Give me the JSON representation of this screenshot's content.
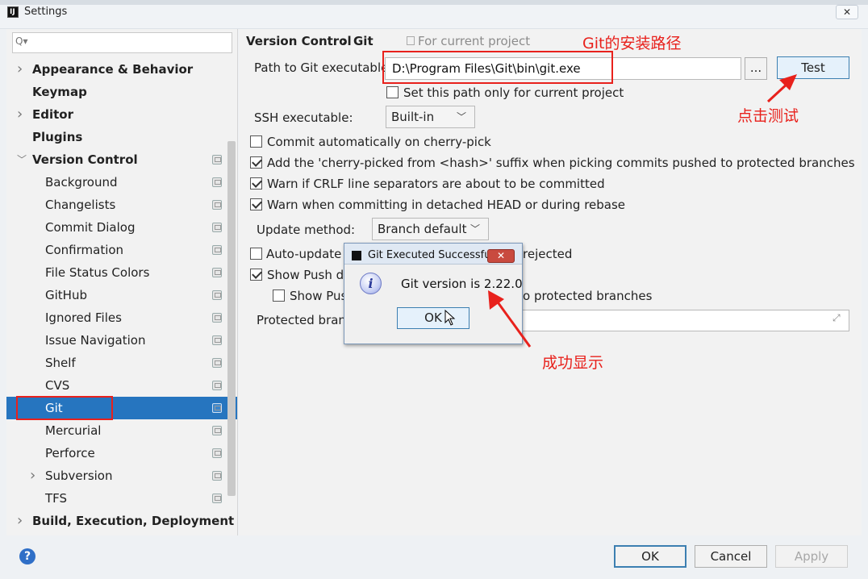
{
  "window": {
    "title": "Settings",
    "close_glyph": "✕"
  },
  "sidebar": {
    "search_placeholder": "Q▾",
    "items": [
      {
        "label": "Appearance & Behavior",
        "bold": true,
        "chevron": "right"
      },
      {
        "label": "Keymap",
        "bold": true
      },
      {
        "label": "Editor",
        "bold": true,
        "chevron": "right"
      },
      {
        "label": "Plugins",
        "bold": true
      },
      {
        "label": "Version Control",
        "bold": true,
        "chevron": "down",
        "project": true
      },
      {
        "label": "Background",
        "project": true
      },
      {
        "label": "Changelists",
        "project": true
      },
      {
        "label": "Commit Dialog",
        "project": true
      },
      {
        "label": "Confirmation",
        "project": true
      },
      {
        "label": "File Status Colors",
        "project": true
      },
      {
        "label": "GitHub",
        "project": true
      },
      {
        "label": "Ignored Files",
        "project": true
      },
      {
        "label": "Issue Navigation",
        "project": true
      },
      {
        "label": "Shelf",
        "project": true
      },
      {
        "label": "CVS",
        "project": true
      },
      {
        "label": "Git",
        "project": true,
        "selected": true
      },
      {
        "label": "Mercurial",
        "project": true
      },
      {
        "label": "Perforce",
        "project": true
      },
      {
        "label": "Subversion",
        "project": true,
        "chevron": "right"
      },
      {
        "label": "TFS",
        "project": true
      },
      {
        "label": "Build, Execution, Deployment",
        "bold": true,
        "chevron": "right"
      }
    ]
  },
  "breadcrumb": {
    "part1": "Version Control",
    "separator": "›",
    "part2": "Git",
    "scope": "For current project"
  },
  "git": {
    "path_label": "Path to Git executable:",
    "path_value": "D:\\Program Files\\Git\\bin\\git.exe",
    "browse_label": "...",
    "test_label": "Test",
    "set_path_label": "Set this path only for current project",
    "ssh_label": "SSH executable:",
    "ssh_value": "Built-in",
    "checkboxes": [
      {
        "label": "Commit automatically on cherry-pick",
        "checked": false
      },
      {
        "label": "Add the 'cherry-picked from <hash>' suffix when picking commits pushed to protected branches",
        "checked": true
      },
      {
        "label": "Warn if CRLF line separators are about to be committed",
        "checked": true
      },
      {
        "label": "Warn when committing in detached HEAD or during rebase",
        "checked": true
      }
    ],
    "update_method_label": "Update method:",
    "update_method_value": "Branch default",
    "auto_update_label": "Auto-update i",
    "auto_update_tail": "rejected",
    "show_push_label": "Show Push dia",
    "show_push_sub_label": "Show Push",
    "show_push_sub_tail": "o protected branches",
    "protected_label": "Protected branc"
  },
  "dialog": {
    "title": "Git Executed Successfully",
    "close_glyph": "✕",
    "info_glyph": "i",
    "message": "Git version is 2.22.0",
    "ok_label": "OK"
  },
  "footer": {
    "help_glyph": "?",
    "ok": "OK",
    "cancel": "Cancel",
    "apply": "Apply"
  },
  "annotations": {
    "install_path": "Git的安装路径",
    "click_test": "点击测试",
    "success": "成功显示",
    "color": "#e8211c"
  }
}
